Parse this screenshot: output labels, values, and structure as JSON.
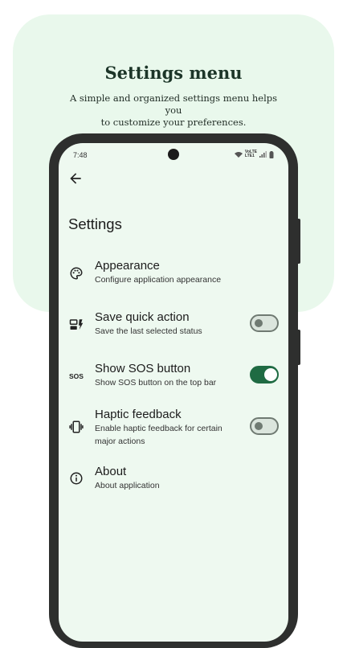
{
  "promo": {
    "title": "Settings menu",
    "subtitle_line1": "A simple and organized settings menu helps you",
    "subtitle_line2": "to customize your preferences."
  },
  "status_bar": {
    "time": "7:48",
    "network_top": "VoLTE",
    "network_bottom": "LTE1"
  },
  "screen": {
    "title": "Settings",
    "back_icon": "arrow-back-icon"
  },
  "settings": [
    {
      "title": "Appearance",
      "description": "Configure application appearance",
      "icon": "palette-icon"
    },
    {
      "title": "Save quick action",
      "description": "Save the last selected status",
      "icon": "quick-action-icon",
      "toggle": false
    },
    {
      "title": "Show SOS button",
      "description": "Show SOS button on the top bar",
      "icon": "sos-icon",
      "icon_text": "SOS",
      "toggle": true
    },
    {
      "title": "Haptic feedback",
      "description": "Enable haptic feedback for certain major actions",
      "icon": "vibration-icon",
      "toggle": false
    },
    {
      "title": "About",
      "description": "About application",
      "icon": "info-icon"
    }
  ],
  "colors": {
    "card_bg": "#e9f8ec",
    "screen_bg": "#eef9f0",
    "toggle_on": "#1f6b43",
    "toggle_off_track": "#dbe5dd",
    "title_text": "#1c3528"
  }
}
